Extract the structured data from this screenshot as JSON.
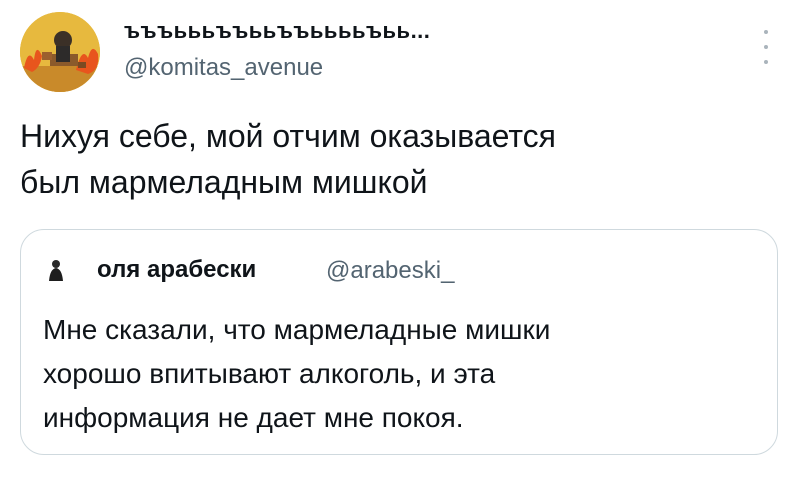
{
  "author": {
    "display_name": "ъъъьььъъььъъььььъьь...",
    "handle": "@komitas_avenue",
    "avatar_icon": "avatar-this-is-fine-icon"
  },
  "tweet": {
    "text_lines": [
      "Нихуя себе, мой отчим оказывается",
      "был мармеладным мишкой"
    ]
  },
  "quoted": {
    "display_name": "оля арабески",
    "handle": "@arabeski_",
    "text_lines": [
      "Мне сказали, что мармеладные мишки",
      "хорошо впитывают алкоголь, и эта",
      "информация не дает мне покоя."
    ]
  },
  "colors": {
    "text": "#0f1419",
    "secondary": "#536471",
    "border": "#cfd9de"
  }
}
